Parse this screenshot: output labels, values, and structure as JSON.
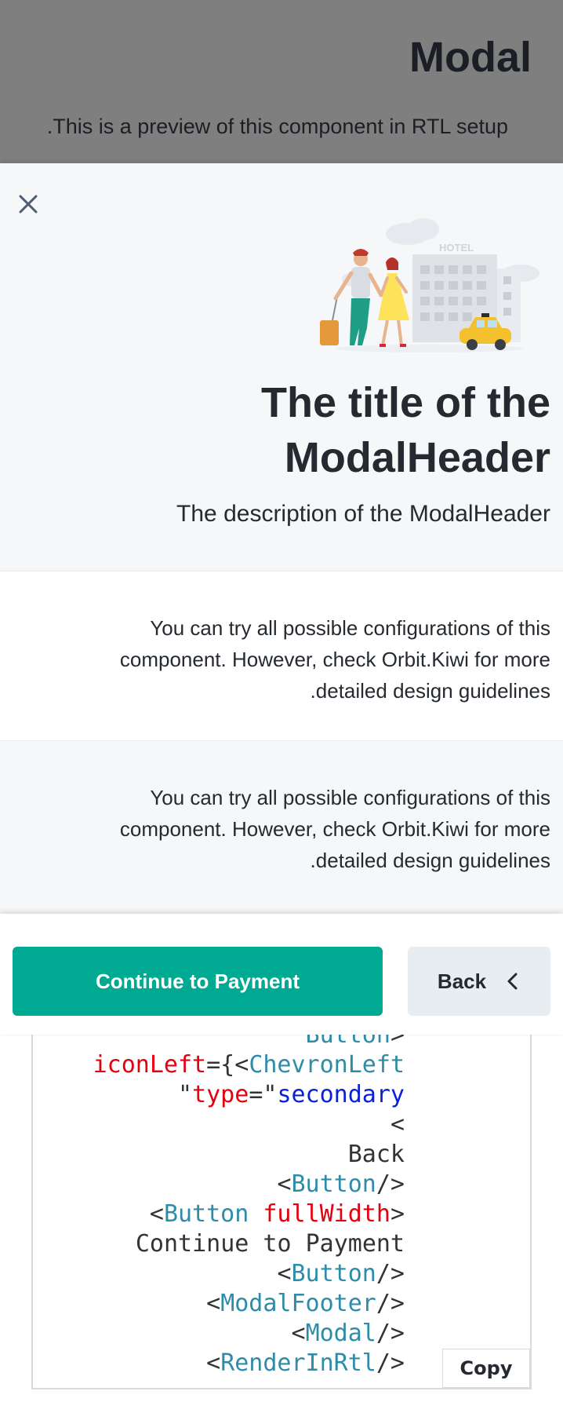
{
  "background": {
    "title": "Modal",
    "description": ".This is a preview of this component in RTL setup"
  },
  "modal": {
    "close_icon": "close-icon",
    "illustration": "hotel-couple-taxi-illustration",
    "illustration_sign": "HOTEL",
    "title": "The title of the ModalHeader",
    "description": "The description of the ModalHeader",
    "sections": [
      {
        "text": "You can try all possible configurations of this component. However, check Orbit.Kiwi for more .detailed design guidelines"
      },
      {
        "text": "You can try all possible configurations of this component. However, check Orbit.Kiwi for more .detailed design guidelines"
      }
    ],
    "footer": {
      "primary_label": "Continue to Payment",
      "secondary_label": "Back",
      "secondary_icon": "chevron-left-icon"
    }
  },
  "code": {
    "lines": [
      [
        {
          "t": "tag",
          "v": "Button"
        },
        {
          "t": "txt",
          "v": ">"
        }
      ],
      [
        {
          "t": "attr",
          "v": "iconLeft"
        },
        {
          "t": "txt",
          "v": "={<"
        },
        {
          "t": "tag",
          "v": "ChevronLeft"
        }
      ],
      [
        {
          "t": "txt",
          "v": "\""
        },
        {
          "t": "attr",
          "v": "type"
        },
        {
          "t": "txt",
          "v": "=\""
        },
        {
          "t": "str",
          "v": "secondary"
        }
      ],
      [
        {
          "t": "txt",
          "v": "<"
        }
      ],
      [
        {
          "t": "txt",
          "v": "Back"
        }
      ],
      [
        {
          "t": "txt",
          "v": "<"
        },
        {
          "t": "tag",
          "v": "Button"
        },
        {
          "t": "txt",
          "v": "/>"
        }
      ],
      [
        {
          "t": "txt",
          "v": "<"
        },
        {
          "t": "tag",
          "v": "Button"
        },
        {
          "t": "txt",
          "v": " "
        },
        {
          "t": "attr",
          "v": "fullWidth"
        },
        {
          "t": "txt",
          "v": ">"
        }
      ],
      [
        {
          "t": "txt",
          "v": "Continue to Payment"
        }
      ],
      [
        {
          "t": "txt",
          "v": "<"
        },
        {
          "t": "tag",
          "v": "Button"
        },
        {
          "t": "txt",
          "v": "/>"
        }
      ],
      [
        {
          "t": "txt",
          "v": "<"
        },
        {
          "t": "tag",
          "v": "ModalFooter"
        },
        {
          "t": "txt",
          "v": "/>"
        }
      ],
      [
        {
          "t": "txt",
          "v": "<"
        },
        {
          "t": "tag",
          "v": "Modal"
        },
        {
          "t": "txt",
          "v": "/>"
        }
      ],
      [
        {
          "t": "txt",
          "v": "<"
        },
        {
          "t": "tag",
          "v": "RenderInRtl"
        },
        {
          "t": "txt",
          "v": "/>"
        }
      ]
    ],
    "copy_label": "Copy"
  },
  "colors": {
    "primary": "#00a991",
    "secondary": "#e8edf1",
    "text": "#252a31",
    "header_bg": "#f5f7f9"
  }
}
